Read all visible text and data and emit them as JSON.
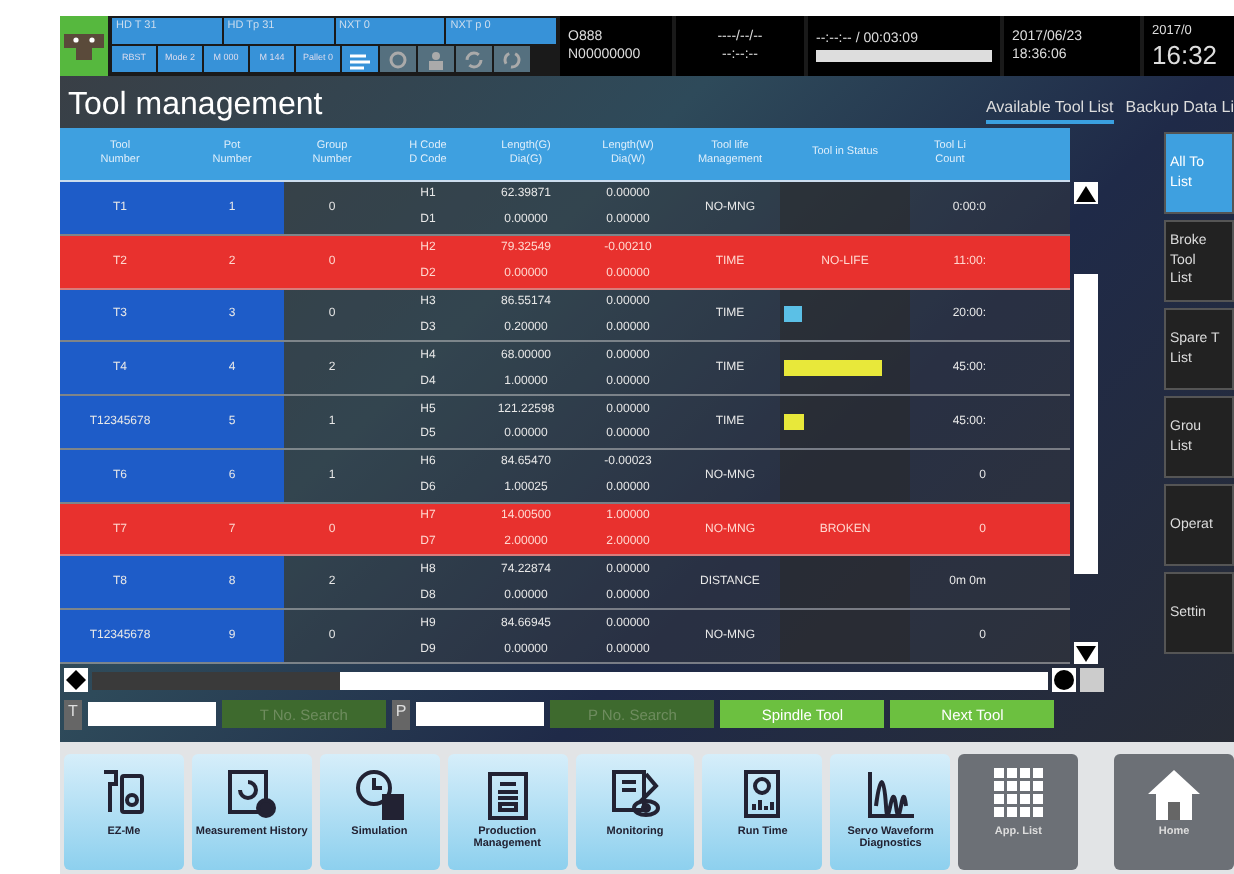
{
  "status_bar": {
    "indicators_top": [
      "HD T 31",
      "HD Tp 31",
      "NXT 0",
      "NXT p 0"
    ],
    "indicators_bottom": [
      "RBST",
      "Mode 2",
      "M 000",
      "M 144",
      "Pallet 0"
    ],
    "program": "O888",
    "sequence": "N00000000",
    "date_blank": "----/--/--",
    "time_blank": "--:--:--",
    "cycle": "--:--:-- / 00:03:09",
    "cycle_progress": {
      "level": 1.0
    },
    "run_date": "2017/06/23",
    "run_time": "18:36:06",
    "clock_date": "2017/0",
    "clock_time": "16:32"
  },
  "title": "Tool management",
  "tabs": [
    {
      "label": "Available Tool List",
      "selected": true
    },
    {
      "label": "Backup Data Li",
      "selected": false
    }
  ],
  "table": {
    "columns": [
      [
        "Tool",
        "Number"
      ],
      [
        "Pot",
        "Number"
      ],
      [
        "Group",
        "Number"
      ],
      [
        "H Code",
        "D Code"
      ],
      [
        "Length(G)",
        "Dia(G)"
      ],
      [
        "Length(W)",
        "Dia(W)"
      ],
      [
        "Tool life",
        "Management"
      ],
      [
        "Tool in Status"
      ],
      [
        "Tool Li",
        "Count"
      ]
    ],
    "rows": [
      {
        "tool": "T1",
        "pot": "1",
        "group": "0",
        "h": "H1",
        "d": "D1",
        "len_g": "62.39871",
        "dia_g": "0.00000",
        "len_w": "0.00000",
        "dia_w": "0.00000",
        "life": "NO-MNG",
        "count": "0:00:0",
        "alert": false
      },
      {
        "tool": "T2",
        "pot": "2",
        "group": "0",
        "h": "H2",
        "d": "D2",
        "len_g": "79.32549",
        "dia_g": "0.00000",
        "len_w": "-0.00210",
        "dia_w": "0.00000",
        "life": "TIME",
        "status": {
          "kind": "text",
          "text": "NO-LIFE"
        },
        "count": "11:00:",
        "alert": true
      },
      {
        "tool": "T3",
        "pot": "3",
        "group": "0",
        "h": "H3",
        "d": "D3",
        "len_g": "86.55174",
        "dia_g": "0.20000",
        "len_w": "0.00000",
        "dia_w": "0.00000",
        "life": "TIME",
        "status": {
          "kind": "bar",
          "level": 0.15,
          "color": "#5bc0e6"
        },
        "count": "20:00:",
        "alert": false
      },
      {
        "tool": "T4",
        "pot": "4",
        "group": "2",
        "h": "H4",
        "d": "D4",
        "len_g": "68.00000",
        "dia_g": "1.00000",
        "len_w": "0.00000",
        "dia_w": "0.00000",
        "life": "TIME",
        "status": {
          "kind": "bar",
          "level": 0.85,
          "color": "#e8e83a"
        },
        "count": "45:00:",
        "alert": false
      },
      {
        "tool": "T12345678",
        "pot": "5",
        "group": "1",
        "h": "H5",
        "d": "D5",
        "len_g": "121.22598",
        "dia_g": "0.00000",
        "len_w": "0.00000",
        "dia_w": "0.00000",
        "life": "TIME",
        "status": {
          "kind": "bar",
          "level": 0.18,
          "color": "#e8e83a"
        },
        "count": "45:00:",
        "alert": false
      },
      {
        "tool": "T6",
        "pot": "6",
        "group": "1",
        "h": "H6",
        "d": "D6",
        "len_g": "84.65470",
        "dia_g": "1.00025",
        "len_w": "-0.00023",
        "dia_w": "0.00000",
        "life": "NO-MNG",
        "count": "0",
        "alert": false
      },
      {
        "tool": "T7",
        "pot": "7",
        "group": "0",
        "h": "H7",
        "d": "D7",
        "len_g": "14.00500",
        "dia_g": "2.00000",
        "len_w": "1.00000",
        "dia_w": "2.00000",
        "life": "NO-MNG",
        "status": {
          "kind": "text",
          "text": "BROKEN"
        },
        "count": "0",
        "alert": true
      },
      {
        "tool": "T8",
        "pot": "8",
        "group": "2",
        "h": "H8",
        "d": "D8",
        "len_g": "74.22874",
        "dia_g": "0.00000",
        "len_w": "0.00000",
        "dia_w": "0.00000",
        "life": "DISTANCE",
        "count": "0m  0m",
        "alert": false
      },
      {
        "tool": "T12345678",
        "pot": "9",
        "group": "0",
        "h": "H9",
        "d": "D9",
        "len_g": "84.66945",
        "dia_g": "0.00000",
        "len_w": "0.00000",
        "dia_w": "0.00000",
        "life": "NO-MNG",
        "count": "0",
        "alert": false
      }
    ]
  },
  "side_menu": [
    {
      "label": "All To\nList",
      "selected": true
    },
    {
      "label": "Broke\nTool\nList",
      "selected": false
    },
    {
      "label": "Spare T\nList",
      "selected": false
    },
    {
      "label": "Grou\nList",
      "selected": false
    },
    {
      "label": "Operat",
      "selected": false
    },
    {
      "label": "Settin",
      "selected": false
    }
  ],
  "search": [
    {
      "kind": "label",
      "text": "T"
    },
    {
      "kind": "field"
    },
    {
      "kind": "button",
      "text": "T No. Search",
      "disabled": true
    },
    {
      "kind": "label",
      "text": "P"
    },
    {
      "kind": "field"
    },
    {
      "kind": "button",
      "text": "P No. Search",
      "disabled": true
    },
    {
      "kind": "button",
      "text": "Spindle Tool",
      "disabled": false
    },
    {
      "kind": "button",
      "text": "Next Tool",
      "disabled": false
    }
  ],
  "apps": [
    {
      "label": "EZ-Me",
      "kind": "app"
    },
    {
      "label": "Measurement History",
      "kind": "app"
    },
    {
      "label": "Simulation",
      "kind": "app"
    },
    {
      "label": "Production Management",
      "kind": "app"
    },
    {
      "label": "Monitoring",
      "kind": "app"
    },
    {
      "label": "Run Time",
      "kind": "app"
    },
    {
      "label": "Servo Waveform Diagnostics",
      "kind": "app"
    },
    {
      "label": "App. List",
      "kind": "nav"
    },
    {
      "label": "Home",
      "kind": "nav"
    }
  ]
}
